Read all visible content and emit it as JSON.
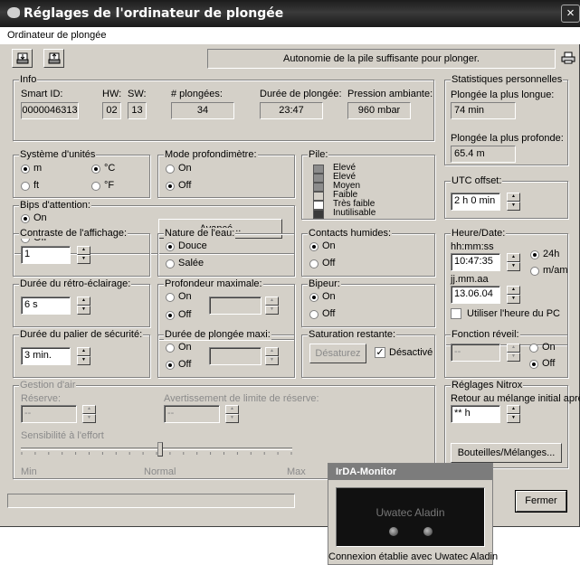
{
  "window": {
    "title": "Réglages de l'ordinateur de plongée",
    "close": "×"
  },
  "menu": {
    "item": "Ordinateur de plongée"
  },
  "toolbar": {
    "status": "Autonomie de la pile suffisante pour plonger."
  },
  "info": {
    "title": "Info",
    "smart_id_label": "Smart ID:",
    "smart_id": "0000046313",
    "hw_label": "HW:",
    "hw": "02",
    "sw_label": "SW:",
    "sw": "13",
    "dives_label": "# plongées:",
    "dives": "34",
    "duration_label": "Durée de plongée:",
    "duration": "23:47",
    "pressure_label": "Pression ambiante:",
    "pressure": "960 mbar"
  },
  "stats": {
    "title": "Statistiques personnelles",
    "longest_label": "Plongée la plus longue:",
    "longest": "74 min",
    "deepest_label": "Plongée la plus profonde:",
    "deepest": "65.4 m"
  },
  "units": {
    "title": "Système d'unités",
    "m": "m",
    "c": "°C",
    "ft": "ft",
    "f": "°F"
  },
  "depth_mode": {
    "title": "Mode profondimètre:",
    "on": "On",
    "off": "Off"
  },
  "battery": {
    "title": "Pile:",
    "levels": [
      "Elevé",
      "Elevé",
      "Moyen",
      "Faible",
      "Très faible",
      "Inutilisable"
    ],
    "colors": [
      "#8c8c8c",
      "#8c8c8c",
      "#8c8c8c",
      "#d4d0c8",
      "#ffffff",
      "#3a3a3a"
    ]
  },
  "beeps": {
    "title": "Bips d'attention:",
    "on": "On",
    "off": "Off",
    "advanced": "Avancé..."
  },
  "utc": {
    "title": "UTC offset:",
    "value": "2 h 0 min"
  },
  "contrast": {
    "title": "Contraste de l'affichage:",
    "value": "1"
  },
  "water": {
    "title": "Nature de l'eau:",
    "fresh": "Douce",
    "salt": "Salée"
  },
  "wet": {
    "title": "Contacts humides:",
    "on": "On",
    "off": "Off"
  },
  "datetime": {
    "title": "Heure/Date:",
    "time_label": "hh:mm:ss",
    "time": "10:47:35",
    "date_label": "jj.mm.aa",
    "date": "13.06.04",
    "h24": "24h",
    "ampm": "m/am",
    "use_pc": "Utiliser l'heure du PC"
  },
  "backlight": {
    "title": "Durée du rétro-éclairage:",
    "value": "6 s"
  },
  "maxdepth": {
    "title": "Profondeur maximale:",
    "on": "On",
    "off": "Off",
    "value": ""
  },
  "beeper": {
    "title": "Bipeur:",
    "on": "On",
    "off": "Off"
  },
  "safety": {
    "title": "Durée du palier de sécurité:",
    "value": "3 min."
  },
  "maxdive": {
    "title": "Durée de plongée maxi:",
    "on": "On",
    "off": "Off",
    "value": ""
  },
  "saturation": {
    "title": "Saturation restante:",
    "desat": "Désaturez",
    "disabled": "Désactivé"
  },
  "wake": {
    "title": "Fonction réveil:",
    "value": "--",
    "on": "On",
    "off": "Off"
  },
  "air": {
    "title": "Gestion d'air",
    "reserve_label": "Réserve:",
    "reserve": "--",
    "warn_label": "Avertissement de limite de réserve:",
    "warn": "--",
    "effort_label": "Sensibilité à l'effort",
    "min": "Min",
    "normal": "Normal",
    "max": "Max"
  },
  "nitrox": {
    "title": "Réglages Nitrox",
    "return_label": "Retour au mélange initial après:",
    "return_value": "** h",
    "bottles": "Bouteilles/Mélanges..."
  },
  "close_button": "Fermer",
  "irda": {
    "title": "IrDA-Monitor",
    "device": "Uwatec Aladin",
    "status": "Connexion établie avec Uwatec Aladin"
  }
}
